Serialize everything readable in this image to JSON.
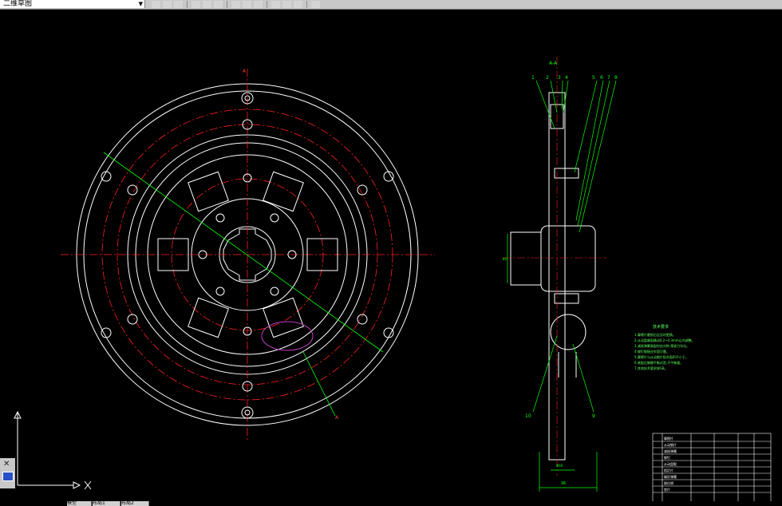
{
  "toolbar": {
    "workspace_name": "二维草图",
    "button_icons": [
      "layer-icon",
      "match-prop-icon",
      "save-icon",
      "pan-icon",
      "zoom-realtime-icon",
      "zoom-window-icon",
      "zoom-previous-icon",
      "properties-icon",
      "design-center-icon",
      "tool-palette-icon",
      "dimension-icon",
      "text-style-icon",
      "table-icon"
    ]
  },
  "drawing": {
    "section_label": "A-A",
    "section_marker_top": "A",
    "section_marker_bottom": "A",
    "balloons": [
      "1",
      "2",
      "3",
      "4",
      "5",
      "6",
      "7",
      "8",
      "10",
      "9"
    ],
    "tech_notes_title": "技术要求",
    "tech_notes": [
      "1.摩擦片磨损后应及时更换。",
      "2.从动盘端面跳动0.2~0.3mm以内调整。",
      "3.减振弹簧装配时应对称,预紧力均匀。",
      "4.铆钉铆接应牢固可靠。",
      "5.摩擦片与从动钢片贴合面积不小于。",
      "6.装配后做静平衡试验,不平衡量。",
      "7.其他技术要求按GB。"
    ],
    "dim_side_width": "96",
    "dim_hub": "Φ60",
    "dim_hub_height": "80"
  },
  "title_block": {
    "rows": [
      "摩擦片",
      "从动钢片",
      "减振弹簧",
      "铆钉",
      "从动盘毂",
      "阻尼片",
      "碟形弹簧",
      "限位销",
      "垫片"
    ]
  },
  "statusbar": {
    "tabs": [
      "模型",
      "布局1",
      "布局2"
    ]
  },
  "colors": {
    "background": "#000000",
    "lines": "#ffffff",
    "centerlines": "#ff2020",
    "dimensions": "#00ff00",
    "highlight": "#c040c0"
  }
}
